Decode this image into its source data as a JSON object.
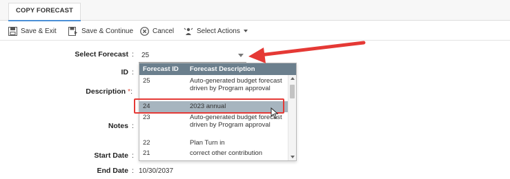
{
  "tab": {
    "label": "COPY FORECAST"
  },
  "toolbar": {
    "save_exit": "Save & Exit",
    "save_continue": "Save & Continue",
    "cancel": "Cancel",
    "select_actions": "Select Actions"
  },
  "form": {
    "select_forecast": {
      "label": "Select Forecast",
      "value": "25"
    },
    "id": {
      "label": "ID"
    },
    "description": {
      "label": "Description",
      "required_mark": "*"
    },
    "notes": {
      "label": "Notes"
    },
    "start_date": {
      "label": "Start Date"
    },
    "end_date": {
      "label": "End Date",
      "value": "10/30/2037"
    },
    "colon": ":"
  },
  "dropdown": {
    "headers": {
      "id": "Forecast ID",
      "description": "Forecast Description"
    },
    "rows": [
      {
        "id": "25",
        "description": "Auto-generated budget forecast driven by Program approval"
      },
      {
        "id": "24",
        "description": "2023 annual"
      },
      {
        "id": "23",
        "description": "Auto-generated budget forecast driven by Program approval"
      },
      {
        "id": "22",
        "description": "Plan Turn in"
      },
      {
        "id": "21",
        "description": "correct other contribution"
      }
    ],
    "highlighted_id": "24"
  },
  "colors": {
    "accent": "#4a8fd6",
    "dropdown_header": "#6b7f8d",
    "row_highlight": "#a7b5bf",
    "annotation": "#e53935",
    "required": "#e04a3c"
  },
  "icons": {
    "save_exit": "save-icon",
    "save_continue": "save-continue-icon",
    "cancel": "cancel-icon",
    "select_actions": "actions-icon"
  }
}
